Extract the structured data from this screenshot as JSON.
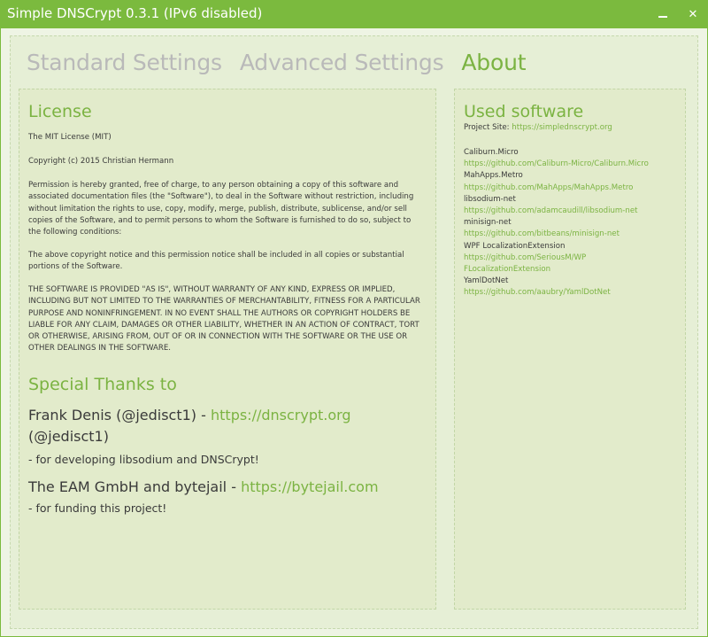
{
  "window": {
    "title": "Simple DNSCrypt 0.3.1 (IPv6 disabled)",
    "minimize_glyph": "minimize-icon",
    "close_glyph": "✕"
  },
  "tabs": [
    {
      "label": "Standard Settings",
      "active": false
    },
    {
      "label": "Advanced Settings",
      "active": false
    },
    {
      "label": "About",
      "active": true
    }
  ],
  "license": {
    "heading": "License",
    "type": "The MIT License (MIT)",
    "copyright": "Copyright (c) 2015 Christian Hermann",
    "permission": "Permission is hereby granted, free of charge, to any person obtaining a copy of this software and associated documentation files (the \"Software\"), to deal in the Software without restriction, including without limitation the rights to use, copy, modify, merge, publish, distribute, sublicense, and/or sell copies of the Software, and to permit persons to whom the Software is furnished to do so, subject to the following conditions:",
    "notice": "The above copyright notice and this permission notice shall be included in all copies or substantial portions of the Software.",
    "warranty": "THE SOFTWARE IS PROVIDED \"AS IS\", WITHOUT WARRANTY OF ANY KIND, EXPRESS OR IMPLIED, INCLUDING BUT NOT LIMITED TO THE WARRANTIES OF MERCHANTABILITY, FITNESS FOR A PARTICULAR PURPOSE AND NONINFRINGEMENT. IN NO EVENT SHALL THE AUTHORS OR COPYRIGHT HOLDERS BE LIABLE FOR ANY CLAIM, DAMAGES OR OTHER LIABILITY, WHETHER IN AN ACTION OF CONTRACT, TORT OR OTHERWISE, ARISING FROM, OUT OF OR IN CONNECTION WITH THE SOFTWARE OR THE USE OR OTHER DEALINGS IN THE SOFTWARE."
  },
  "thanks": {
    "heading": "Special Thanks to",
    "items": [
      {
        "name": "Frank Denis (@jedisct1) - ",
        "link": "https://dnscrypt.org",
        "extra": "(@jedisct1)",
        "reason": "- for developing libsodium and DNSCrypt!"
      },
      {
        "name": "The EAM GmbH and bytejail - ",
        "link": "https://bytejail.com",
        "reason": "- for funding this project!"
      }
    ]
  },
  "used_software": {
    "heading": "Used software",
    "project_site_label": "Project Site: ",
    "project_site_link": "https://simplednscrypt.org",
    "items": [
      {
        "name": "Caliburn.Micro",
        "link": "https://github.com/Caliburn-Micro/Caliburn.Micro"
      },
      {
        "name": "MahApps.Metro",
        "link": "https://github.com/MahApps/MahApps.Metro"
      },
      {
        "name": "libsodium-net",
        "link": "https://github.com/adamcaudill/libsodium-net"
      },
      {
        "name": "minisign-net",
        "link": "https://github.com/bitbeans/minisign-net"
      },
      {
        "name": "WPF LocalizationExtension",
        "link": "https://github.com/SeriousM/WPFLocalizationExtension"
      },
      {
        "name": "YamlDotNet",
        "link": "https://github.com/aaubry/YamlDotNet"
      }
    ]
  },
  "colors": {
    "accent": "#7bba3e",
    "text": "#3a3a3a",
    "inactive_tab": "#b9b9b9"
  }
}
